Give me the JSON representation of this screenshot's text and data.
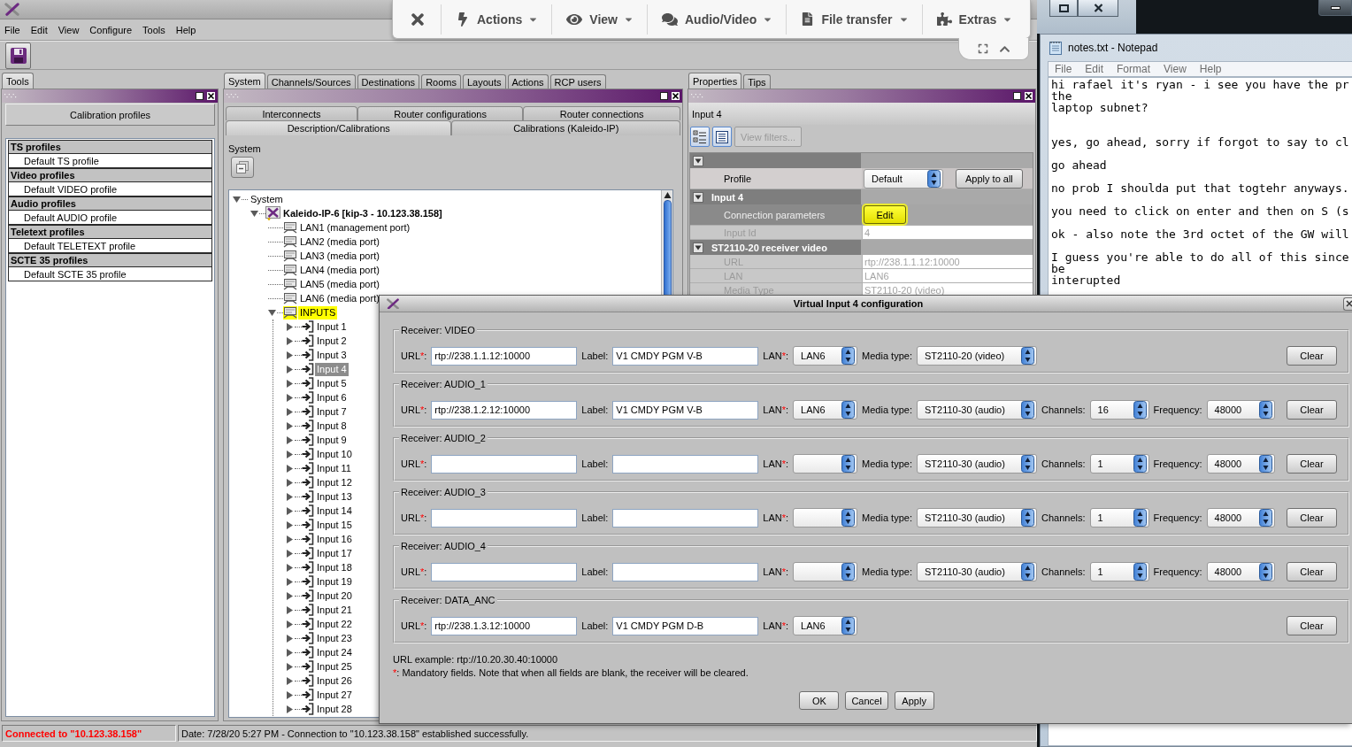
{
  "app": {
    "menu": [
      "File",
      "Edit",
      "View",
      "Configure",
      "Tools",
      "Help"
    ],
    "left": {
      "tabs": [
        {
          "label": "Tools",
          "selected": true
        }
      ],
      "header": "Calibration profiles",
      "profile_groups": [
        {
          "title": "TS profiles",
          "items": [
            "Default TS profile"
          ]
        },
        {
          "title": "Video profiles",
          "items": [
            "Default VIDEO profile"
          ]
        },
        {
          "title": "Audio profiles",
          "items": [
            "Default AUDIO profile"
          ]
        },
        {
          "title": "Teletext profiles",
          "items": [
            "Default TELETEXT profile"
          ]
        },
        {
          "title": "SCTE 35 profiles",
          "items": [
            "Default SCTE 35 profile"
          ]
        }
      ]
    },
    "middle": {
      "tabs": [
        {
          "label": "System",
          "selected": true
        },
        {
          "label": "Channels/Sources",
          "selected": false
        },
        {
          "label": "Destinations",
          "selected": false
        },
        {
          "label": "Rooms",
          "selected": false
        },
        {
          "label": "Layouts",
          "selected": false
        },
        {
          "label": "Actions",
          "selected": false
        },
        {
          "label": "RCP users",
          "selected": false
        }
      ],
      "subtabs": [
        [
          {
            "label": "Interconnects",
            "selected": false
          },
          {
            "label": "Router configurations",
            "selected": false
          },
          {
            "label": "Router connections",
            "selected": false
          }
        ],
        [
          {
            "label": "Description/Calibrations",
            "selected": true
          },
          {
            "label": "Calibrations (Kaleido-IP)",
            "selected": false
          }
        ]
      ],
      "section_label": "System",
      "tree": [
        {
          "kind": "root",
          "label": "System",
          "expanded": true,
          "selected": false,
          "highlighted": false,
          "children": [
            {
              "kind": "device",
              "label": "Kaleido-IP-6 [kip-3 - 10.123.38.158]",
              "expanded": true,
              "selected": false,
              "highlighted": false,
              "children": [
                {
                  "kind": "port",
                  "label": "LAN1 (management port)",
                  "selected": false,
                  "highlighted": false
                },
                {
                  "kind": "port",
                  "label": "LAN2 (media port)",
                  "selected": false,
                  "highlighted": false
                },
                {
                  "kind": "port",
                  "label": "LAN3 (media port)",
                  "selected": false,
                  "highlighted": false
                },
                {
                  "kind": "port",
                  "label": "LAN4 (media port)",
                  "selected": false,
                  "highlighted": false
                },
                {
                  "kind": "port",
                  "label": "LAN5 (media port)",
                  "selected": false,
                  "highlighted": false
                },
                {
                  "kind": "port",
                  "label": "LAN6 (media port)",
                  "selected": false,
                  "highlighted": false
                },
                {
                  "kind": "folder",
                  "label": "INPUTS",
                  "expanded": true,
                  "selected": false,
                  "highlighted": true,
                  "children": [
                    {
                      "kind": "input",
                      "label": "Input 1",
                      "expanded": false,
                      "selected": false,
                      "highlighted": false
                    },
                    {
                      "kind": "input",
                      "label": "Input 2",
                      "expanded": false,
                      "selected": false,
                      "highlighted": false
                    },
                    {
                      "kind": "input",
                      "label": "Input 3",
                      "expanded": false,
                      "selected": false,
                      "highlighted": false
                    },
                    {
                      "kind": "input",
                      "label": "Input 4",
                      "expanded": false,
                      "selected": true,
                      "highlighted": false
                    },
                    {
                      "kind": "input",
                      "label": "Input 5",
                      "expanded": false,
                      "selected": false,
                      "highlighted": false
                    },
                    {
                      "kind": "input",
                      "label": "Input 6",
                      "expanded": false,
                      "selected": false,
                      "highlighted": false
                    },
                    {
                      "kind": "input",
                      "label": "Input 7",
                      "expanded": false,
                      "selected": false,
                      "highlighted": false
                    },
                    {
                      "kind": "input",
                      "label": "Input 8",
                      "expanded": false,
                      "selected": false,
                      "highlighted": false
                    },
                    {
                      "kind": "input",
                      "label": "Input 9",
                      "expanded": false,
                      "selected": false,
                      "highlighted": false
                    },
                    {
                      "kind": "input",
                      "label": "Input 10",
                      "expanded": false,
                      "selected": false,
                      "highlighted": false
                    },
                    {
                      "kind": "input",
                      "label": "Input 11",
                      "expanded": false,
                      "selected": false,
                      "highlighted": false
                    },
                    {
                      "kind": "input",
                      "label": "Input 12",
                      "expanded": false,
                      "selected": false,
                      "highlighted": false
                    },
                    {
                      "kind": "input",
                      "label": "Input 13",
                      "expanded": false,
                      "selected": false,
                      "highlighted": false
                    },
                    {
                      "kind": "input",
                      "label": "Input 14",
                      "expanded": false,
                      "selected": false,
                      "highlighted": false
                    },
                    {
                      "kind": "input",
                      "label": "Input 15",
                      "expanded": false,
                      "selected": false,
                      "highlighted": false
                    },
                    {
                      "kind": "input",
                      "label": "Input 16",
                      "expanded": false,
                      "selected": false,
                      "highlighted": false
                    },
                    {
                      "kind": "input",
                      "label": "Input 17",
                      "expanded": false,
                      "selected": false,
                      "highlighted": false
                    },
                    {
                      "kind": "input",
                      "label": "Input 18",
                      "expanded": false,
                      "selected": false,
                      "highlighted": false
                    },
                    {
                      "kind": "input",
                      "label": "Input 19",
                      "expanded": false,
                      "selected": false,
                      "highlighted": false
                    },
                    {
                      "kind": "input",
                      "label": "Input 20",
                      "expanded": false,
                      "selected": false,
                      "highlighted": false
                    },
                    {
                      "kind": "input",
                      "label": "Input 21",
                      "expanded": false,
                      "selected": false,
                      "highlighted": false
                    },
                    {
                      "kind": "input",
                      "label": "Input 22",
                      "expanded": false,
                      "selected": false,
                      "highlighted": false
                    },
                    {
                      "kind": "input",
                      "label": "Input 23",
                      "expanded": false,
                      "selected": false,
                      "highlighted": false
                    },
                    {
                      "kind": "input",
                      "label": "Input 24",
                      "expanded": false,
                      "selected": false,
                      "highlighted": false
                    },
                    {
                      "kind": "input",
                      "label": "Input 25",
                      "expanded": false,
                      "selected": false,
                      "highlighted": false
                    },
                    {
                      "kind": "input",
                      "label": "Input 26",
                      "expanded": false,
                      "selected": false,
                      "highlighted": false
                    },
                    {
                      "kind": "input",
                      "label": "Input 27",
                      "expanded": false,
                      "selected": false,
                      "highlighted": false
                    },
                    {
                      "kind": "input",
                      "label": "Input 28",
                      "expanded": false,
                      "selected": false,
                      "highlighted": false
                    }
                  ]
                }
              ]
            }
          ]
        }
      ]
    },
    "right": {
      "tabs": [
        {
          "label": "Properties",
          "selected": true
        },
        {
          "label": "Tips",
          "selected": false
        }
      ],
      "title": "Input 4",
      "view_buttons": [
        {
          "kind": "categorized"
        },
        {
          "kind": "list"
        }
      ],
      "filter_button": {
        "label": "View filters...",
        "disabled": true
      },
      "property_groups": [
        {
          "expanded": true,
          "rows": [
            {
              "kind": "select",
              "name": "Profile",
              "value": "Default",
              "action": "Apply to all",
              "selected": false,
              "disabled": false
            }
          ]
        },
        {
          "title": "Input 4",
          "expanded": true,
          "rows": [
            {
              "kind": "button",
              "name": "Connection parameters",
              "value": "Edit",
              "selected": true,
              "disabled": false,
              "highlighted": true
            },
            {
              "kind": "text",
              "name": "Input Id",
              "value": "4",
              "selected": false,
              "disabled": true
            }
          ]
        },
        {
          "title": "ST2110-20 receiver video",
          "expanded": true,
          "rows": [
            {
              "kind": "text",
              "name": "URL",
              "value": "rtp://238.1.1.12:10000",
              "selected": false,
              "disabled": true
            },
            {
              "kind": "text",
              "name": "LAN",
              "value": "LAN6",
              "selected": false,
              "disabled": true
            },
            {
              "kind": "text",
              "name": "Media Type",
              "value": "ST2110-20 (video)",
              "selected": false,
              "disabled": true
            }
          ]
        }
      ]
    },
    "status": {
      "connection": "Connected to \"10.123.38.158\"",
      "message": "Date: 7/28/20 5:27 PM - Connection to \"10.123.38.158\" established successfully."
    }
  },
  "remote_toolbar": {
    "items": [
      {
        "kind": "close"
      },
      {
        "kind": "bolt",
        "label": "Actions"
      },
      {
        "kind": "eye",
        "label": "View"
      },
      {
        "kind": "chat",
        "label": "Audio/Video"
      },
      {
        "kind": "document",
        "label": "File transfer"
      },
      {
        "kind": "puzzle",
        "label": "Extras"
      }
    ]
  },
  "notepad": {
    "title": "notes.txt - Notepad",
    "menu": [
      "File",
      "Edit",
      "Format",
      "View",
      "Help"
    ],
    "lines": [
      {
        "kind": "text",
        "text": "hi rafael it's ryan - i see you have the pr"
      },
      {
        "kind": "text",
        "text": "the"
      },
      {
        "kind": "text",
        "text": "laptop subnet?"
      },
      {
        "kind": "blank"
      },
      {
        "kind": "blank"
      },
      {
        "kind": "text",
        "text": "yes, go ahead, sorry if forgot to say to cl"
      },
      {
        "kind": "blank"
      },
      {
        "kind": "text",
        "text": "go ahead"
      },
      {
        "kind": "blank"
      },
      {
        "kind": "text",
        "text": "no prob I shoulda put that togtehr anyways."
      },
      {
        "kind": "blank"
      },
      {
        "kind": "text",
        "text": "you need to click on enter and then on S (s"
      },
      {
        "kind": "blank"
      },
      {
        "kind": "text",
        "text": "ok - also note the 3rd octet of the GW will"
      },
      {
        "kind": "blank"
      },
      {
        "kind": "text",
        "text": "I guess you're able to do all of this since"
      },
      {
        "kind": "text",
        "text": "be"
      },
      {
        "kind": "text",
        "text": "interupted"
      }
    ]
  },
  "dialog": {
    "title": "Virtual Input 4 configuration",
    "receivers": [
      {
        "legend": "Receiver: VIDEO",
        "fields": [
          {
            "kind": "text",
            "label": "URL",
            "mark": "*",
            "end": ":",
            "value": "rtp://238.1.1.12:10000"
          },
          {
            "kind": "text",
            "label": "Label:",
            "value": "V1 CMDY PGM V-B"
          },
          {
            "kind": "select",
            "label": "LAN",
            "mark": "*",
            "end": ":",
            "value": "LAN6"
          },
          {
            "kind": "select",
            "label": "Media type:",
            "value": "ST2110-20 (video)"
          }
        ],
        "clear": "Clear"
      },
      {
        "legend": "Receiver: AUDIO_1",
        "fields": [
          {
            "kind": "text",
            "label": "URL",
            "mark": "*",
            "end": ":",
            "value": "rtp://238.1.2.12:10000"
          },
          {
            "kind": "text",
            "label": "Label:",
            "value": "V1 CMDY PGM V-B"
          },
          {
            "kind": "select",
            "label": "LAN",
            "mark": "*",
            "end": ":",
            "value": "LAN6"
          },
          {
            "kind": "select",
            "label": "Media type:",
            "value": "ST2110-30 (audio)"
          },
          {
            "kind": "select",
            "label": "Channels:",
            "value": "16"
          },
          {
            "kind": "select",
            "label": "Frequency:",
            "value": "48000"
          }
        ],
        "clear": "Clear"
      },
      {
        "legend": "Receiver: AUDIO_2",
        "fields": [
          {
            "kind": "text",
            "label": "URL",
            "mark": "*",
            "end": ":"
          },
          {
            "kind": "text",
            "label": "Label:"
          },
          {
            "kind": "select",
            "label": "LAN",
            "mark": "*",
            "end": ":"
          },
          {
            "kind": "select",
            "label": "Media type:",
            "value": "ST2110-30 (audio)"
          },
          {
            "kind": "select",
            "label": "Channels:",
            "value": "1"
          },
          {
            "kind": "select",
            "label": "Frequency:",
            "value": "48000"
          }
        ],
        "clear": "Clear"
      },
      {
        "legend": "Receiver: AUDIO_3",
        "fields": [
          {
            "kind": "text",
            "label": "URL",
            "mark": "*",
            "end": ":"
          },
          {
            "kind": "text",
            "label": "Label:"
          },
          {
            "kind": "select",
            "label": "LAN",
            "mark": "*",
            "end": ":"
          },
          {
            "kind": "select",
            "label": "Media type:",
            "value": "ST2110-30 (audio)"
          },
          {
            "kind": "select",
            "label": "Channels:",
            "value": "1"
          },
          {
            "kind": "select",
            "label": "Frequency:",
            "value": "48000"
          }
        ],
        "clear": "Clear"
      },
      {
        "legend": "Receiver: AUDIO_4",
        "fields": [
          {
            "kind": "text",
            "label": "URL",
            "mark": "*",
            "end": ":"
          },
          {
            "kind": "text",
            "label": "Label:"
          },
          {
            "kind": "select",
            "label": "LAN",
            "mark": "*",
            "end": ":"
          },
          {
            "kind": "select",
            "label": "Media type:",
            "value": "ST2110-30 (audio)"
          },
          {
            "kind": "select",
            "label": "Channels:",
            "value": "1"
          },
          {
            "kind": "select",
            "label": "Frequency:",
            "value": "48000"
          }
        ],
        "clear": "Clear"
      },
      {
        "legend": "Receiver: DATA_ANC",
        "fields": [
          {
            "kind": "text",
            "label": "URL",
            "mark": "*",
            "end": ":",
            "value": "rtp://238.1.3.12:10000"
          },
          {
            "kind": "text",
            "label": "Label:",
            "value": "V1 CMDY PGM D-B"
          },
          {
            "kind": "select",
            "label": "LAN",
            "mark": "*",
            "end": ":",
            "value": "LAN6"
          }
        ],
        "clear": "Clear"
      }
    ],
    "example": "URL example: rtp://10.20.30.40:10000",
    "note_mark": "*",
    "note": ": Mandatory fields. Note that when all fields are blank, the receiver will be cleared.",
    "buttons": [
      "OK",
      "Cancel",
      "Apply"
    ]
  }
}
